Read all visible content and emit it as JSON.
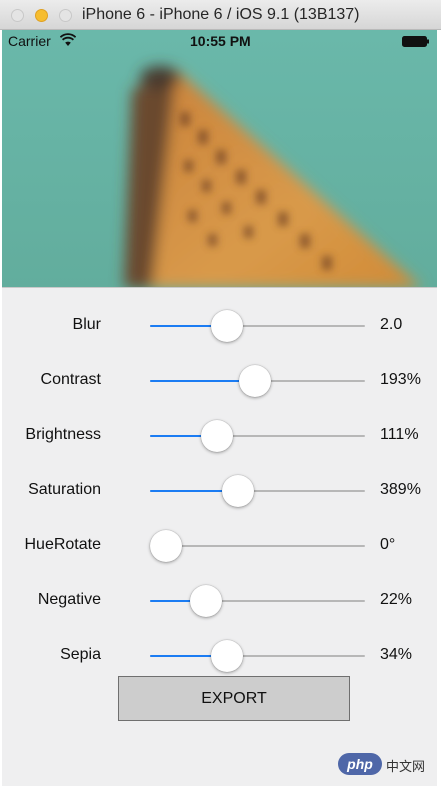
{
  "window": {
    "title": "iPhone 6 - iPhone 6 / iOS 9.1 (13B137)"
  },
  "status_bar": {
    "carrier": "Carrier",
    "time": "10:55 PM",
    "wifi_icon": "wifi-icon",
    "battery_icon": "battery-icon"
  },
  "photo": {
    "subject": "blurred-building-photo"
  },
  "colors": {
    "accent": "#1b7cf3",
    "track": "#b7b7b7",
    "screen_background": "#efeff0",
    "button_background": "#cdcdcd"
  },
  "sliders": [
    {
      "label": "Blur",
      "value": "2.0",
      "level": 0.36
    },
    {
      "label": "Contrast",
      "value": "193%",
      "level": 0.49
    },
    {
      "label": "Brightness",
      "value": "111%",
      "level": 0.31
    },
    {
      "label": "Saturation",
      "value": "389%",
      "level": 0.41
    },
    {
      "label": "HueRotate",
      "value": "0°",
      "level": 0.0
    },
    {
      "label": "Negative",
      "value": "22%",
      "level": 0.26
    },
    {
      "label": "Sepia",
      "value": "34%",
      "level": 0.36
    }
  ],
  "export_button": {
    "label": "EXPORT"
  },
  "watermark": {
    "badge": "php",
    "text": "中文网"
  }
}
